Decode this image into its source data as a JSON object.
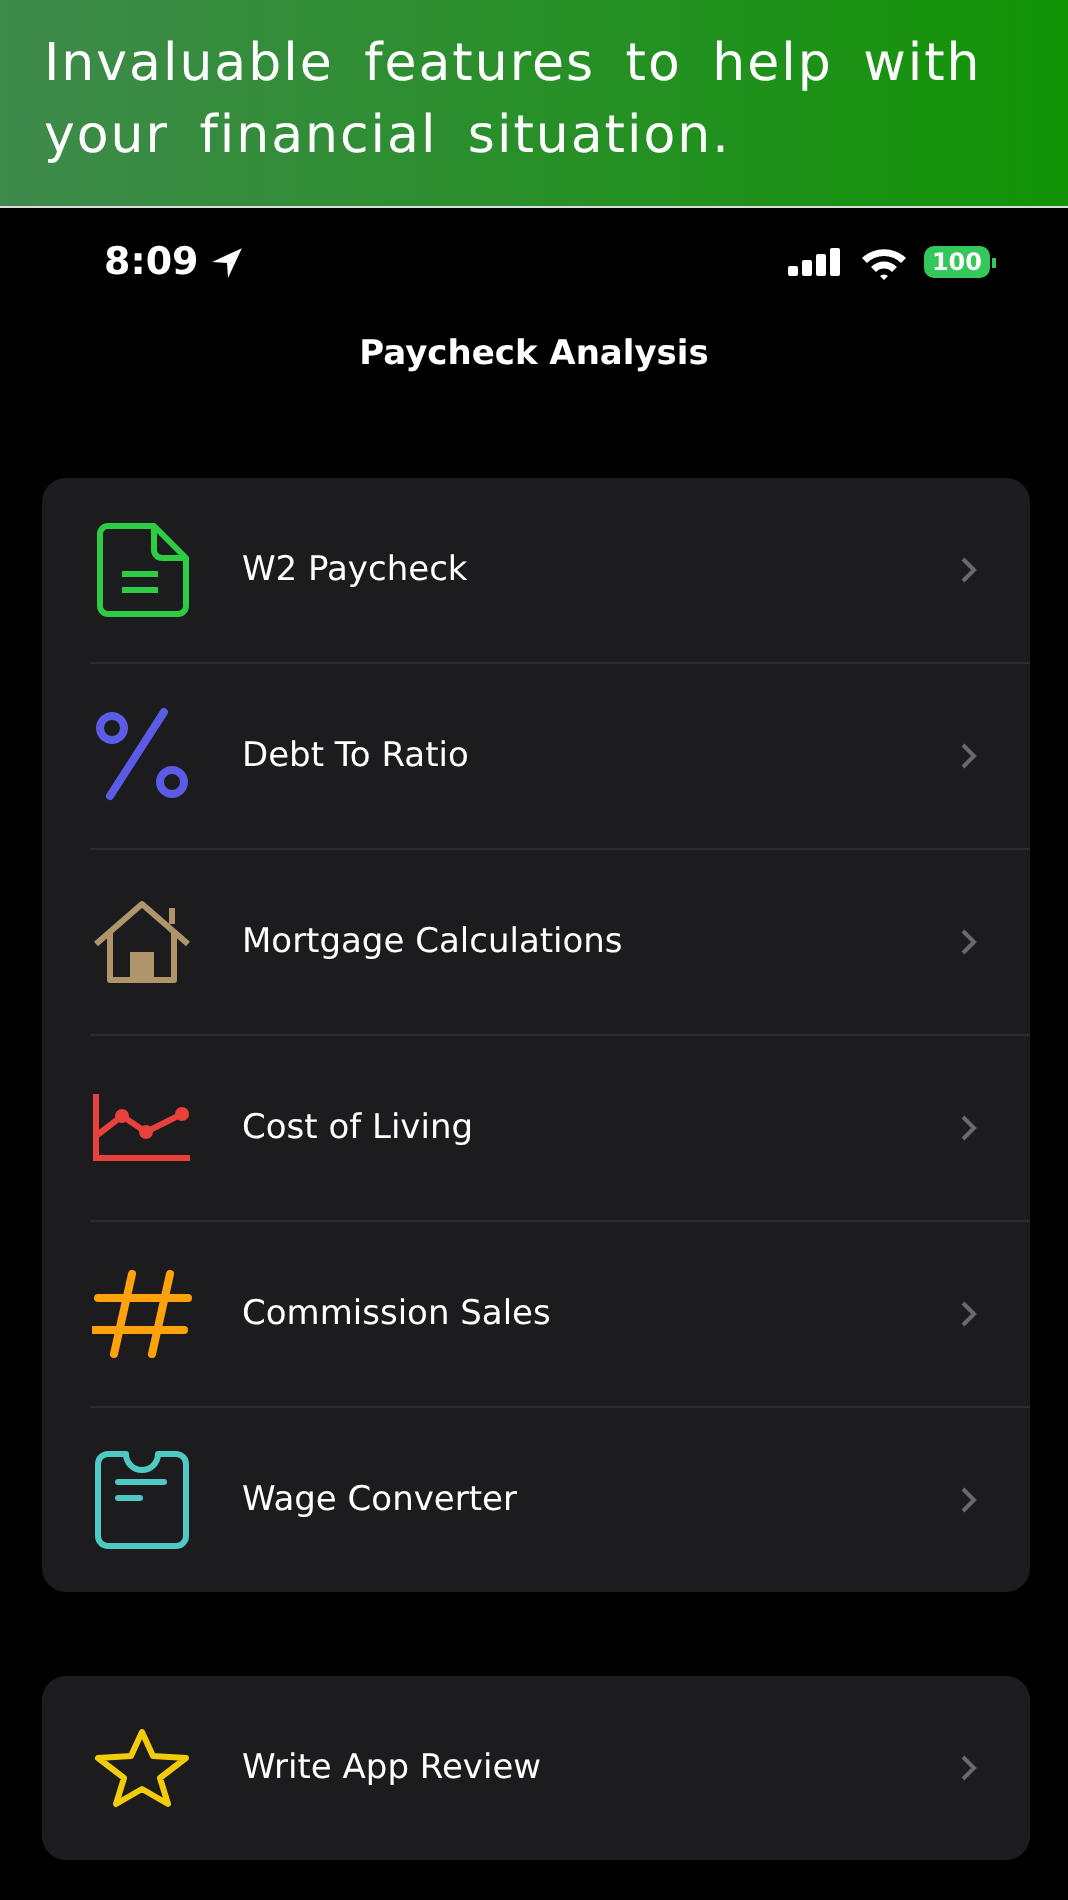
{
  "banner": {
    "text": "Invaluable features to help with your financial situation."
  },
  "status_bar": {
    "time": "8:09",
    "battery": "100"
  },
  "title": "Paycheck Analysis",
  "sections": [
    {
      "items": [
        {
          "label": "W2 Paycheck",
          "kind": "document"
        },
        {
          "label": "Debt To Ratio",
          "kind": "percent"
        },
        {
          "label": "Mortgage Calculations",
          "kind": "house"
        },
        {
          "label": "Cost of Living",
          "kind": "chart"
        },
        {
          "label": "Commission Sales",
          "kind": "hash"
        },
        {
          "label": "Wage Converter",
          "kind": "clipboard"
        }
      ]
    },
    {
      "items": [
        {
          "label": "Write App Review",
          "kind": "star"
        }
      ]
    }
  ]
}
